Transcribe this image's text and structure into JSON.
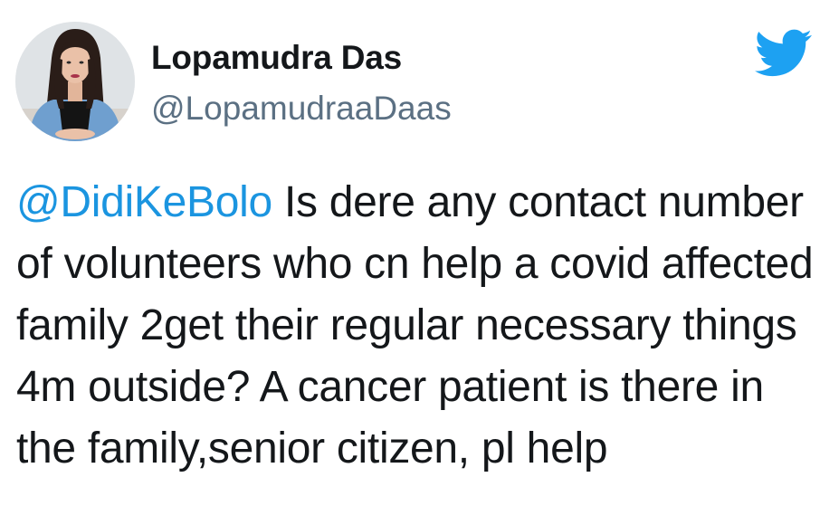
{
  "author": {
    "display_name": "Lopamudra Das",
    "handle": "@LopamudraaDaas",
    "avatar_icon": "profile-photo"
  },
  "brand": {
    "icon": "twitter-bird-icon",
    "color": "#1da1f2"
  },
  "tweet": {
    "mention": "@DidiKeBolo",
    "text": " Is dere any contact number of volunteers who cn help a covid affected family 2get their regular necessary things 4m outside? A cancer patient is there in the family,senior citizen, pl help",
    "mention_color": "#1b95e0"
  }
}
